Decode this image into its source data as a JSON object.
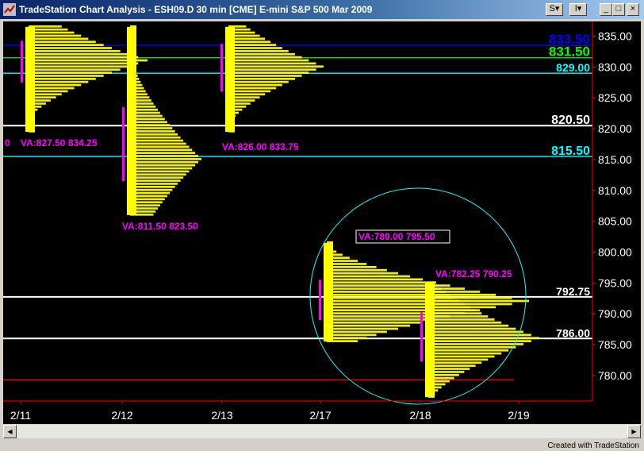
{
  "window": {
    "title": "TradeStation Chart Analysis - ESH09.D  30 min  [CME] E-mini S&P 500 Mar 2009",
    "buttons": {
      "symbol_menu": "S",
      "interval_menu": "I",
      "minimize": "_",
      "maximize": "□",
      "close": "×"
    }
  },
  "colors": {
    "background": "#000000",
    "profile": "#ffff00",
    "value_area": "#ff00ff",
    "level_blue": "#0000ff",
    "level_green": "#00ff00",
    "level_cyan": "#00ffff",
    "level_white": "#ffffff",
    "level_red": "#ff0000"
  },
  "chart_data": {
    "type": "market-profile",
    "x_ticks": [
      "2/11",
      "2/12",
      "2/13",
      "2/17",
      "2/18",
      "2/19"
    ],
    "y_ticks": [
      835.0,
      830.0,
      825.0,
      820.0,
      815.0,
      810.0,
      805.0,
      800.0,
      795.0,
      790.0,
      785.0,
      780.0
    ],
    "ylim": [
      776,
      837
    ],
    "levels": [
      {
        "label": "833.50",
        "value": 833.5,
        "color": "#0000ff"
      },
      {
        "label": "831.50",
        "value": 831.5,
        "color": "#00ff00"
      },
      {
        "label": "829.00",
        "value": 829.0,
        "color": "#00ffff"
      },
      {
        "label": "820.50",
        "value": 820.5,
        "color": "#ffffff"
      },
      {
        "label": "815.50",
        "value": 815.5,
        "color": "#00ffff"
      },
      {
        "label": "792.75",
        "value": 792.75,
        "color": "#ffffff"
      },
      {
        "label": "786.00",
        "value": 786.0,
        "color": "#ffffff"
      },
      {
        "label": "",
        "value": 779.3,
        "color": "#ff0000"
      }
    ],
    "profiles": [
      {
        "day": "2/11",
        "high": 836.5,
        "low": 819.5,
        "poc": 831.0,
        "va_low": 827.5,
        "va_high": 834.25
      },
      {
        "day": "2/12",
        "high": 836.5,
        "low": 806.0,
        "poc": 815.0,
        "va_low": 811.5,
        "va_high": 823.5
      },
      {
        "day": "2/13",
        "high": 836.5,
        "low": 819.5,
        "poc": 830.0,
        "va_low": 826.0,
        "va_high": 833.75
      },
      {
        "day": "2/17",
        "high": 801.5,
        "low": 785.5,
        "poc": 792.0,
        "va_low": 789.0,
        "va_high": 795.5
      },
      {
        "day": "2/18",
        "high": 795.0,
        "low": 776.5,
        "poc": 786.0,
        "va_low": 782.25,
        "va_high": 790.25
      }
    ],
    "va_labels": [
      {
        "text": "VA:827.50 834.25",
        "boxed": false
      },
      {
        "text": "VA:811.50 823.50",
        "boxed": false
      },
      {
        "text": "VA:826.00 833.75",
        "boxed": false
      },
      {
        "text": "VA:789.00 795.50",
        "boxed": true
      },
      {
        "text": "VA:782.25 790.25",
        "boxed": false
      }
    ],
    "edge_label": "0",
    "annotation": {
      "shape": "circle",
      "color": "#00ffff"
    }
  },
  "footer": "Created with TradeStation"
}
